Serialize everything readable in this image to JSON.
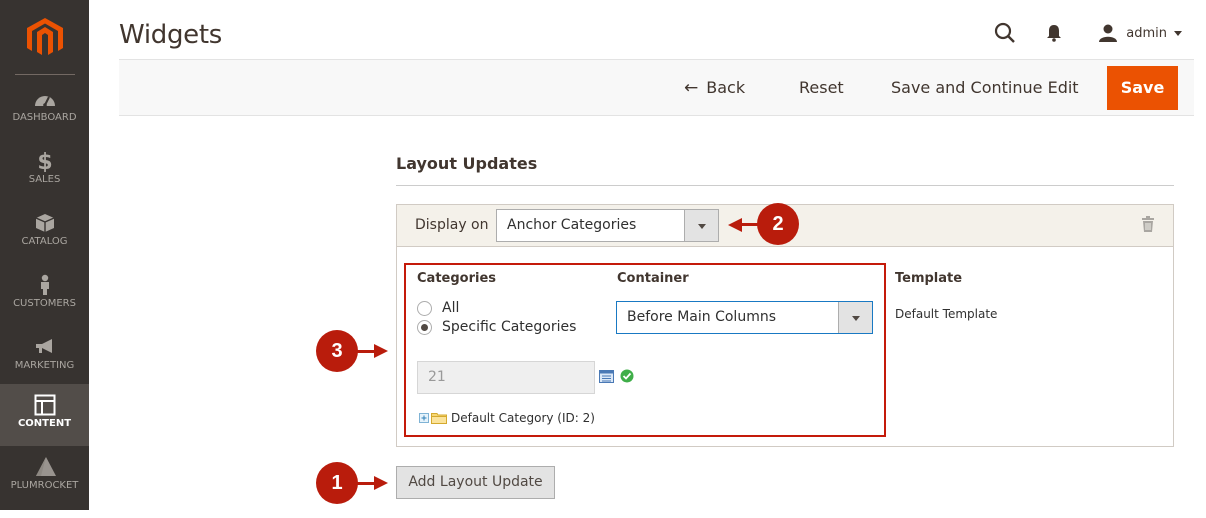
{
  "sidebar": {
    "logo": "magento-logo",
    "items": [
      {
        "label": "DASHBOARD",
        "icon": "dashboard-icon",
        "active": false
      },
      {
        "label": "SALES",
        "icon": "dollar-icon",
        "active": false
      },
      {
        "label": "CATALOG",
        "icon": "box-icon",
        "active": false
      },
      {
        "label": "CUSTOMERS",
        "icon": "person-icon",
        "active": false
      },
      {
        "label": "MARKETING",
        "icon": "megaphone-icon",
        "active": false
      },
      {
        "label": "CONTENT",
        "icon": "layout-icon",
        "active": true
      },
      {
        "label": "PLUMROCKET",
        "icon": "pyramid-icon",
        "active": false
      }
    ]
  },
  "header": {
    "title": "Widgets",
    "user": "admin"
  },
  "actions": {
    "back": "Back",
    "reset": "Reset",
    "save_continue": "Save and Continue Edit",
    "save": "Save"
  },
  "layout_updates": {
    "title": "Layout Updates",
    "display_on_label": "Display on",
    "display_on_value": "Anchor Categories",
    "categories_label": "Categories",
    "radio_all": "All",
    "radio_specific": "Specific Categories",
    "selected_radio": "Specific Categories",
    "category_ids": "21",
    "tree_root": "Default Category (ID: 2)",
    "container_label": "Container",
    "container_value": "Before Main Columns",
    "template_label": "Template",
    "template_value": "Default Template",
    "add_button": "Add Layout Update"
  },
  "callouts": [
    "1",
    "2",
    "3"
  ],
  "colors": {
    "accent": "#eb5202",
    "sidebar_bg": "#373330",
    "callout_red": "#b91c0c"
  }
}
